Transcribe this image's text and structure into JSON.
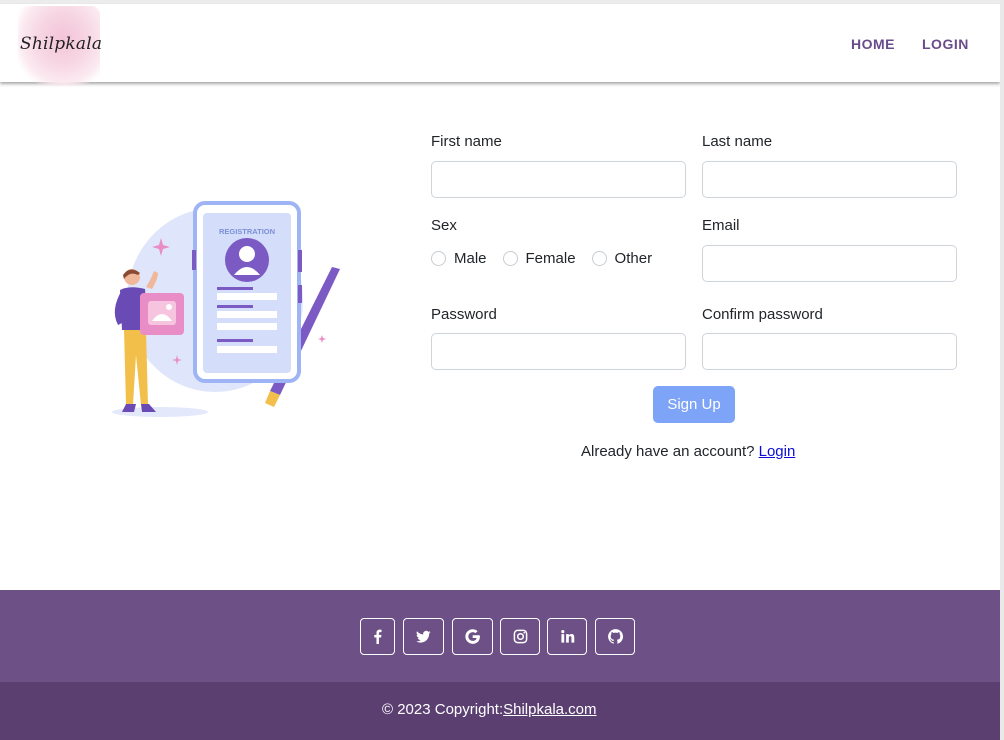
{
  "brand": {
    "logo_text": "Shilpkala"
  },
  "nav": {
    "home_label": "HOME",
    "login_label": "LOGIN"
  },
  "illustration": {
    "card_title": "REGISTRATION"
  },
  "form": {
    "first_name_label": "First name",
    "last_name_label": "Last name",
    "sex_label": "Sex",
    "sex_options": [
      "Male",
      "Female",
      "Other"
    ],
    "email_label": "Email",
    "password_label": "Password",
    "confirm_password_label": "Confirm password",
    "first_name_value": "",
    "last_name_value": "",
    "email_value": "",
    "password_value": "",
    "confirm_password_value": "",
    "signup_label": "Sign Up",
    "already_text": "Already have an account?",
    "login_link": "Login"
  },
  "footer": {
    "social_icons": [
      "facebook-icon",
      "twitter-icon",
      "google-icon",
      "instagram-icon",
      "linkedin-icon",
      "github-icon"
    ],
    "copyright_text": "© 2023 Copyright:",
    "copyright_link": "Shilpkala.com"
  },
  "colors": {
    "brand_purple": "#6b4c8a",
    "footer_top": "#6d5186",
    "footer_bottom": "#5b3f71",
    "signup_button": "#7ea4f7"
  }
}
